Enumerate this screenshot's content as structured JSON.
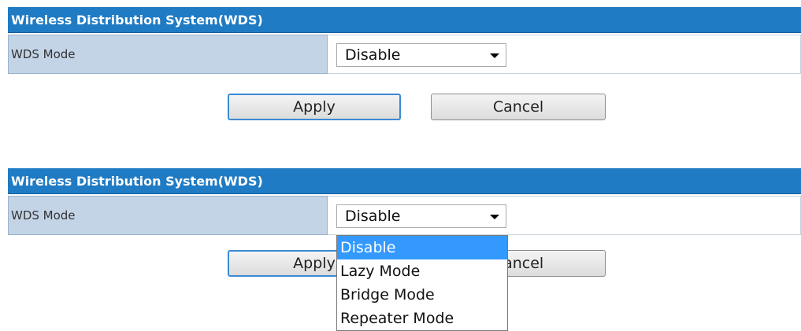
{
  "panel1": {
    "title": "Wireless Distribution System(WDS)",
    "wds_mode_label": "WDS Mode",
    "wds_mode_value": "Disable",
    "apply_label": "Apply",
    "cancel_label": "Cancel"
  },
  "panel2": {
    "title": "Wireless Distribution System(WDS)",
    "wds_mode_label": "WDS Mode",
    "wds_mode_value": "Disable",
    "apply_label": "Apply",
    "cancel_label": "Cancel",
    "dropdown_open": true,
    "options": [
      "Disable",
      "Lazy Mode",
      "Bridge Mode",
      "Repeater Mode"
    ],
    "highlighted_option": "Disable"
  },
  "colors": {
    "header_bg": "#1f7bc4",
    "label_bg": "#c3d4e7",
    "highlight": "#3399ff"
  }
}
